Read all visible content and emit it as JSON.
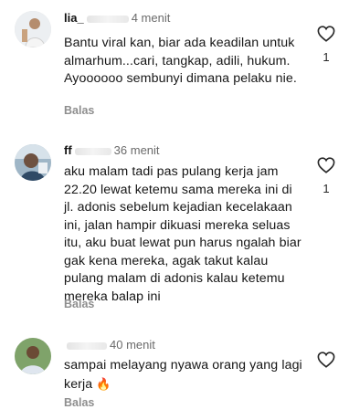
{
  "comments": [
    {
      "username": "lia_",
      "time": "4 menit",
      "text": "Bantu viral kan, biar ada keadilan untuk almarhum...cari, tangkap, adili, hukum. Ayoooooo sembunyi dimana pelaku nie.",
      "reply_label": "Balas",
      "like_count": "1",
      "avatar_icon": "profile-photo",
      "like_icon": "heart-outline-icon"
    },
    {
      "username": "ff",
      "time": "36 menit",
      "text": "aku malam tadi pas pulang kerja jam 22.20 lewat ketemu sama mereka ini di jl. adonis sebelum kejadian kecelakaan ini, jalan hampir dikuasi mereka seluas itu, aku buat lewat pun harus ngalah biar gak kena mereka, agak takut kalau pulang malam di adonis kalau ketemu mereka balap ini",
      "reply_label": "Balas",
      "like_count": "1",
      "avatar_icon": "profile-photo",
      "like_icon": "heart-outline-icon"
    },
    {
      "username": "",
      "time": "40 menit",
      "text": "sampai melayang nyawa orang yang lagi kerja",
      "emoji": "🔥",
      "reply_label": "Balas",
      "like_count": "",
      "avatar_icon": "profile-photo",
      "like_icon": "heart-outline-icon"
    }
  ],
  "colors": {
    "text": "#161616",
    "meta": "#8e8e8e",
    "background": "#ffffff"
  }
}
